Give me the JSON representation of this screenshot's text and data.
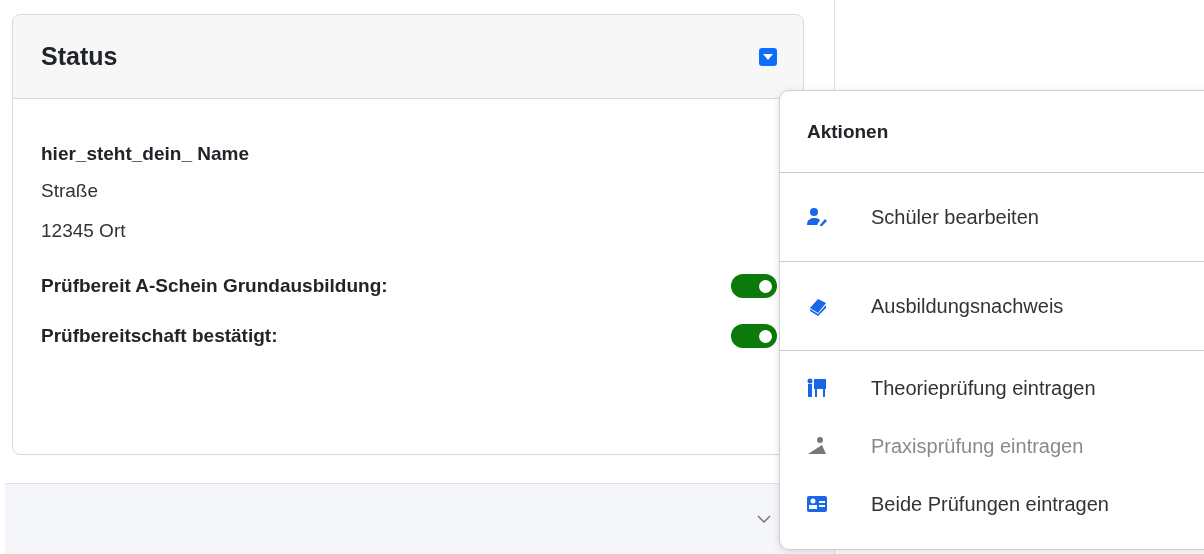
{
  "status_card": {
    "title": "Status",
    "collapse_button": {
      "expanded": true
    },
    "name": "hier_steht_dein_ Name",
    "street": "Straße",
    "city": "12345 Ort",
    "toggles": [
      {
        "label": "Prüfbereit A-Schein Grundausbildung:",
        "on": true
      },
      {
        "label": "Prüfbereitschaft bestätigt:",
        "on": true
      }
    ]
  },
  "footer_panel": {
    "expanded": false
  },
  "actions_menu": {
    "title": "Aktionen",
    "groups": [
      [
        {
          "label": "Schüler bearbeiten",
          "kind": "user-edit",
          "disabled": false
        }
      ],
      [
        {
          "label": "Ausbildungsnachweis",
          "kind": "book",
          "disabled": false
        }
      ],
      [
        {
          "label": "Theorieprüfung eintragen",
          "kind": "board",
          "disabled": false
        },
        {
          "label": "Praxisprüfung eintragen",
          "kind": "ramp",
          "disabled": true
        },
        {
          "label": "Beide Prüfungen eintragen",
          "kind": "card",
          "disabled": false
        }
      ]
    ]
  }
}
